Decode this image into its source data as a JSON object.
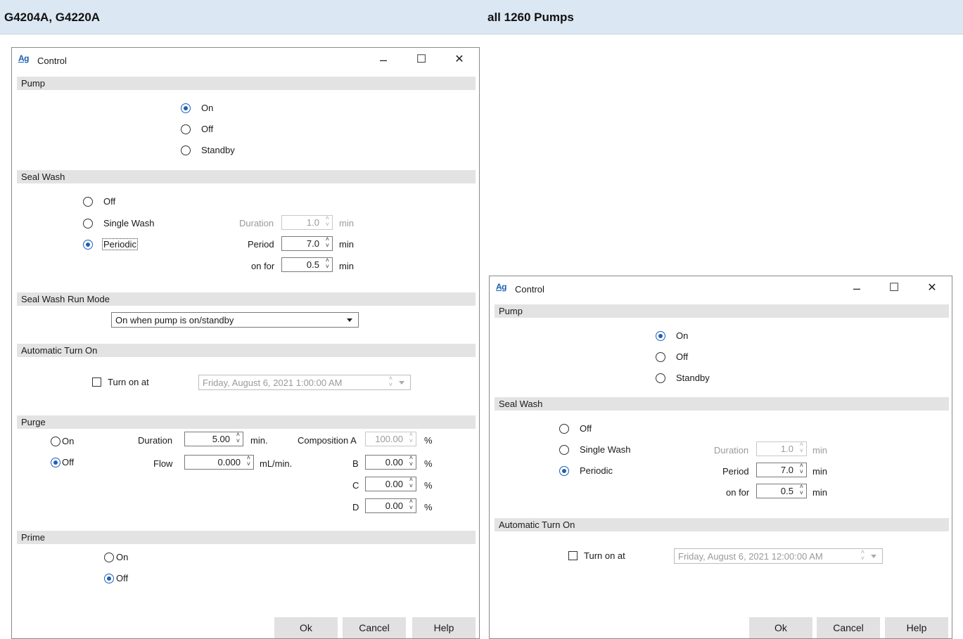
{
  "header": {
    "left": "G4204A, G4220A",
    "right": "all 1260 Pumps"
  },
  "w1": {
    "title": "Control",
    "pump": {
      "label": "Pump",
      "on": "On",
      "off": "Off",
      "standby": "Standby"
    },
    "seal": {
      "label": "Seal Wash",
      "off": "Off",
      "single": "Single Wash",
      "periodic": "Periodic",
      "duration_label": "Duration",
      "duration": "1.0",
      "period_label": "Period",
      "period": "7.0",
      "onfor_label": "on for",
      "onfor": "0.5",
      "unit": "min"
    },
    "runmode": {
      "label": "Seal Wash Run Mode",
      "value": "On when pump is on/standby"
    },
    "auto": {
      "label": "Automatic Turn On",
      "turn_on": "Turn on at",
      "datetime": "Friday, August 6, 2021   1:00:00 AM"
    },
    "purge": {
      "label": "Purge",
      "on": "On",
      "off": "Off",
      "duration_label": "Duration",
      "duration": "5.00",
      "duration_unit": "min.",
      "flow_label": "Flow",
      "flow": "0.000",
      "flow_unit": "mL/min.",
      "compA_label": "Composition A",
      "compA": "100.00",
      "b_label": "B",
      "b": "0.00",
      "c_label": "C",
      "c": "0.00",
      "d_label": "D",
      "d": "0.00",
      "pct": "%"
    },
    "prime": {
      "label": "Prime",
      "on": "On",
      "off": "Off"
    },
    "buttons": {
      "ok": "Ok",
      "cancel": "Cancel",
      "help": "Help"
    }
  },
  "w2": {
    "title": "Control",
    "pump": {
      "label": "Pump",
      "on": "On",
      "off": "Off",
      "standby": "Standby"
    },
    "seal": {
      "label": "Seal Wash",
      "off": "Off",
      "single": "Single Wash",
      "periodic": "Periodic",
      "duration_label": "Duration",
      "duration": "1.0",
      "period_label": "Period",
      "period": "7.0",
      "onfor_label": "on for",
      "onfor": "0.5",
      "unit": "min"
    },
    "auto": {
      "label": "Automatic Turn On",
      "turn_on": "Turn on at",
      "datetime": "Friday, August 6, 2021   12:00:00 AM"
    },
    "buttons": {
      "ok": "Ok",
      "cancel": "Cancel",
      "help": "Help"
    }
  },
  "icons": {
    "app": "Ag",
    "minimize": "–",
    "maximize": "☐",
    "close": "✕",
    "spin": "⌃⌄"
  },
  "colors": {
    "header_bg": "#dbe7f2",
    "section_bg": "#e3e3e3",
    "radio_selected": "#1e5fb8"
  }
}
